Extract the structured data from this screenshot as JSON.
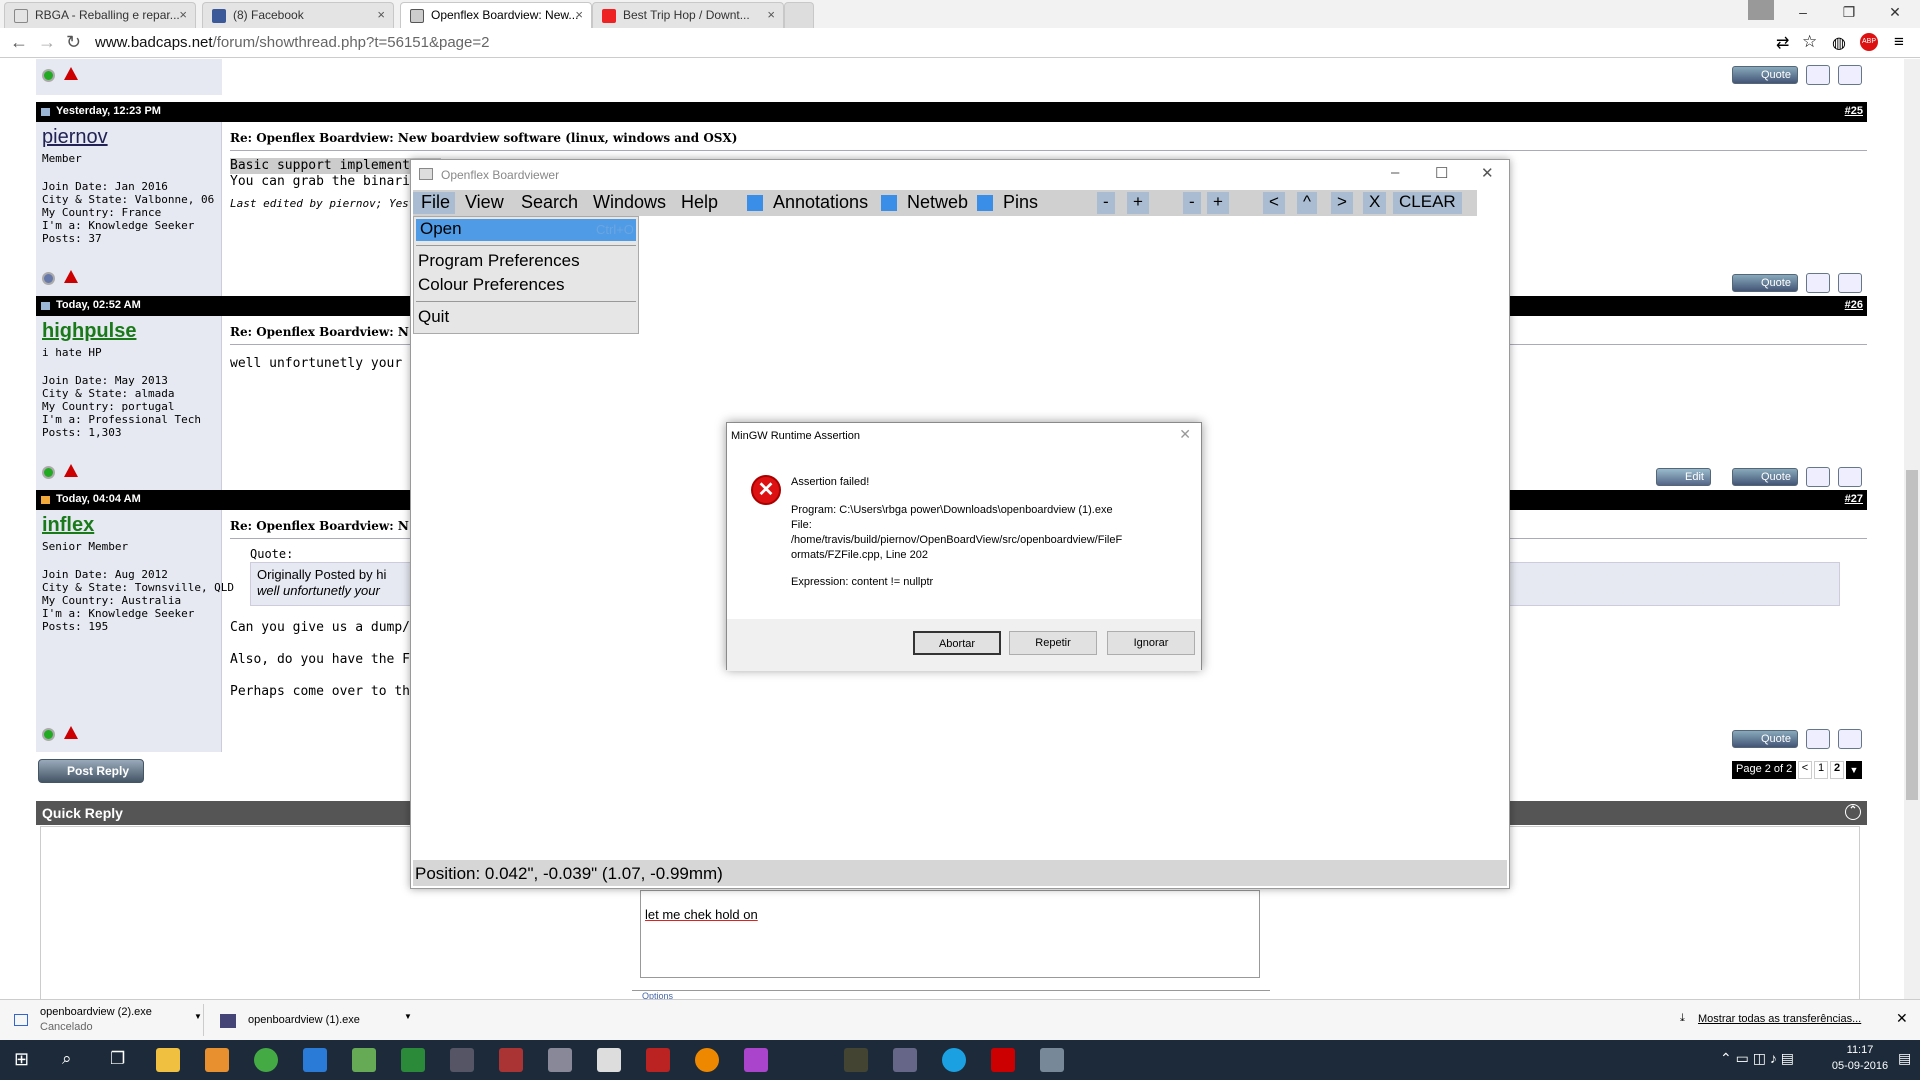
{
  "browser": {
    "tabs": [
      {
        "label": "RBGA - Reballing e repar...",
        "active": false
      },
      {
        "label": "(8) Facebook",
        "active": false
      },
      {
        "label": "Openflex Boardview: New...",
        "active": true
      },
      {
        "label": "Best Trip Hop / Downt...",
        "active": false
      }
    ],
    "url_host": "www.badcaps.net",
    "url_path": "/forum/showthread.php?t=56151&page=2"
  },
  "posts": [
    {
      "header": "Yesterday, 12:23 PM",
      "number": "#25",
      "user": "piernov",
      "title_rank": "Member",
      "info": "Join Date: Jan 2016\nCity & State: Valbonne, 06\nMy Country: France\nI'm a: Knowledge Seeker\nPosts: 37",
      "post_title": "Re: Openflex Boardview: New boardview software (linux, windows and OSX)",
      "text": "Basic support implemented\nYou can grab the binaries h",
      "edited": "Last edited by piernov; Yesterd"
    },
    {
      "header": "Today, 02:52 AM",
      "number": "#26",
      "user": "highpulse",
      "title_rank": "i hate HP",
      "info": "Join Date: May 2013\nCity & State: almada\nMy Country: portugal\nI'm a: Professional Tech\nPosts: 1,303",
      "post_title": "Re: Openflex Boardview: N",
      "text": "well unfortunetly your soft"
    },
    {
      "header": "Today, 04:04 AM",
      "number": "#27",
      "user": "inflex",
      "title_rank": "Senior Member",
      "info": "Join Date: Aug 2012\nCity & State: Townsville, QLD\nMy Country: Australia\nI'm a: Knowledge Seeker\nPosts: 195",
      "post_title": "Re: Openflex Boardview: N",
      "quote_label": "Quote:",
      "quote_by": "Originally Posted by hi",
      "quote_text": "well unfortunetly your",
      "text": "Can you give us a dump/er\n\nAlso, do you have the FZ k\n\nPerhaps come over to the "
    }
  ],
  "buttons": {
    "quote": "Quote",
    "edit": "Edit",
    "post_reply": "Post Reply"
  },
  "pagination": {
    "label": "Page 2 of 2",
    "prev": "<",
    "p1": "1",
    "p2": "2"
  },
  "quick_reply": {
    "title": "Quick Reply",
    "text": "let me chek hold on",
    "options": "Options"
  },
  "openflex": {
    "title": "Openflex Boardviewer",
    "menu": [
      "File",
      "View",
      "Search",
      "Windows",
      "Help"
    ],
    "toggles": [
      "Annotations",
      "Netweb",
      "Pins"
    ],
    "tools": [
      "-",
      "+",
      "-",
      "+",
      "<",
      "^",
      ">",
      "X",
      "CLEAR"
    ],
    "file_menu": {
      "open": "Open",
      "open_shortcut": "Ctrl+O",
      "prefs": "Program Preferences",
      "colours": "Colour Preferences",
      "quit": "Quit"
    },
    "status": "Position: 0.042\", -0.039\" (1.07, -0.99mm)"
  },
  "dialog": {
    "title": "MinGW Runtime Assertion",
    "heading": "Assertion failed!",
    "program": "Program: C:\\Users\\rbga power\\Downloads\\openboardview (1).exe",
    "file": "File:\n/home/travis/build/piernov/OpenBoardView/src/openboardview/FileF\normats/FZFile.cpp, Line 202",
    "expression": "Expression: content != nullptr",
    "buttons": [
      "Abortar",
      "Repetir",
      "Ignorar"
    ]
  },
  "downloads": {
    "items": [
      {
        "name": "openboardview (2).exe",
        "status": "Cancelado"
      },
      {
        "name": "openboardview (1).exe",
        "status": ""
      }
    ],
    "show_all": "Mostrar todas as transferências..."
  },
  "taskbar": {
    "time": "11:17",
    "date": "05-09-2016"
  }
}
